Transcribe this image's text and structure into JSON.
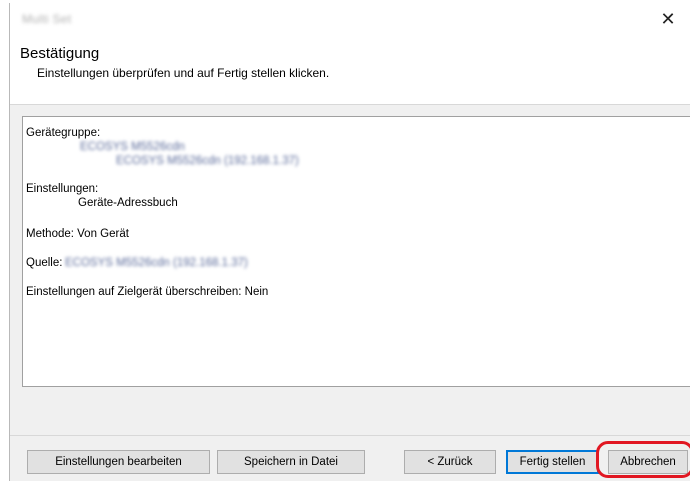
{
  "window": {
    "title": "Multi Set",
    "close_symbol": "✕"
  },
  "header": {
    "title": "Bestätigung",
    "subtitle": "Einstellungen überprüfen und auf Fertig stellen klicken."
  },
  "summary": {
    "group_label": "Gerätegruppe:",
    "group_device_name": "ECOSYS M5526cdn",
    "group_device_full": "ECOSYS M5526cdn (192.168.1.37)",
    "settings_label": "Einstellungen:",
    "settings_value": "Geräte-Adressbuch",
    "method": "Methode: Von Gerät",
    "source_label": "Quelle:",
    "source_value": "ECOSYS M5526cdn (192.168.1.37)",
    "overwrite": "Einstellungen auf Zielgerät überschreiben: Nein"
  },
  "buttons": {
    "edit_settings": "Einstellungen bearbeiten",
    "save_to_file": "Speichern in Datei",
    "back": "< Zurück",
    "finish": "Fertig stellen",
    "cancel": "Abbrechen"
  },
  "colors": {
    "highlight": "#e11722",
    "default_button_border": "#0078d7"
  }
}
